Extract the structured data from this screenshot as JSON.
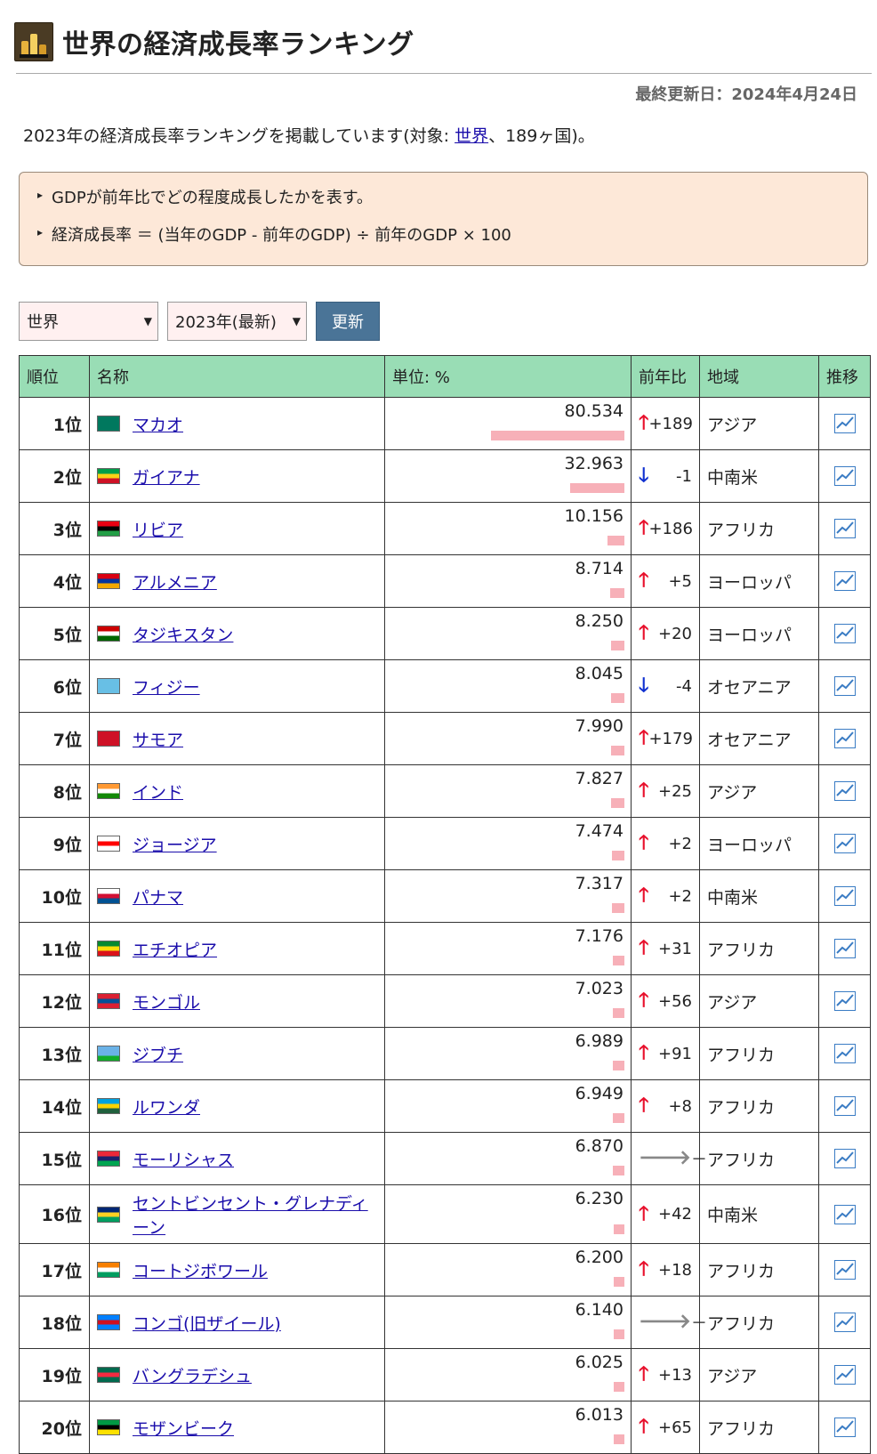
{
  "header": {
    "title": "世界の経済成長率ランキング",
    "updated": "最終更新日：2024年4月24日",
    "intro_before": "2023年の経済成長率ランキングを掲載しています(対象: ",
    "intro_link": "世界",
    "intro_after": "、189ヶ国)。"
  },
  "notes": [
    "GDPが前年比でどの程度成長したかを表す。",
    "経済成長率 ＝ (当年のGDP - 前年のGDP) ÷ 前年のGDP × 100"
  ],
  "controls": {
    "region_select": "世界",
    "year_select": "2023年(最新)",
    "update_button": "更新"
  },
  "table": {
    "headers": {
      "rank": "順位",
      "name": "名称",
      "unit": "単位: %",
      "change": "前年比",
      "region": "地域",
      "trend": "推移"
    },
    "max_value": 80.534,
    "rows": [
      {
        "rank": "1位",
        "name": "マカオ",
        "value": "80.534",
        "v": 80.534,
        "dir": "up",
        "change": "+189",
        "region": "アジア",
        "flag": [
          "#00785e",
          "#00785e",
          "#00785e"
        ]
      },
      {
        "rank": "2位",
        "name": "ガイアナ",
        "value": "32.963",
        "v": 32.963,
        "dir": "down",
        "change": "-1",
        "region": "中南米",
        "flag": [
          "#009e49",
          "#fcd116",
          "#ce1126"
        ]
      },
      {
        "rank": "3位",
        "name": "リビア",
        "value": "10.156",
        "v": 10.156,
        "dir": "up",
        "change": "+186",
        "region": "アフリカ",
        "flag": [
          "#e70013",
          "#000000",
          "#239e46"
        ]
      },
      {
        "rank": "4位",
        "name": "アルメニア",
        "value": "8.714",
        "v": 8.714,
        "dir": "up",
        "change": "+5",
        "region": "ヨーロッパ",
        "flag": [
          "#d90012",
          "#0033a0",
          "#f2a800"
        ]
      },
      {
        "rank": "5位",
        "name": "タジキスタン",
        "value": "8.250",
        "v": 8.25,
        "dir": "up",
        "change": "+20",
        "region": "ヨーロッパ",
        "flag": [
          "#cc0000",
          "#ffffff",
          "#006600"
        ]
      },
      {
        "rank": "6位",
        "name": "フィジー",
        "value": "8.045",
        "v": 8.045,
        "dir": "down",
        "change": "-4",
        "region": "オセアニア",
        "flag": [
          "#68bfe5",
          "#68bfe5",
          "#68bfe5"
        ]
      },
      {
        "rank": "7位",
        "name": "サモア",
        "value": "7.990",
        "v": 7.99,
        "dir": "up",
        "change": "+179",
        "region": "オセアニア",
        "flag": [
          "#ce1126",
          "#ce1126",
          "#ce1126"
        ]
      },
      {
        "rank": "8位",
        "name": "インド",
        "value": "7.827",
        "v": 7.827,
        "dir": "up",
        "change": "+25",
        "region": "アジア",
        "flag": [
          "#ff9933",
          "#ffffff",
          "#138808"
        ]
      },
      {
        "rank": "9位",
        "name": "ジョージア",
        "value": "7.474",
        "v": 7.474,
        "dir": "up",
        "change": "+2",
        "region": "ヨーロッパ",
        "flag": [
          "#ffffff",
          "#ff0000",
          "#ffffff"
        ]
      },
      {
        "rank": "10位",
        "name": "パナマ",
        "value": "7.317",
        "v": 7.317,
        "dir": "up",
        "change": "+2",
        "region": "中南米",
        "flag": [
          "#ffffff",
          "#d21034",
          "#005293"
        ]
      },
      {
        "rank": "11位",
        "name": "エチオピア",
        "value": "7.176",
        "v": 7.176,
        "dir": "up",
        "change": "+31",
        "region": "アフリカ",
        "flag": [
          "#078930",
          "#fcdd09",
          "#da121a"
        ]
      },
      {
        "rank": "12位",
        "name": "モンゴル",
        "value": "7.023",
        "v": 7.023,
        "dir": "up",
        "change": "+56",
        "region": "アジア",
        "flag": [
          "#da2032",
          "#015197",
          "#da2032"
        ]
      },
      {
        "rank": "13位",
        "name": "ジブチ",
        "value": "6.989",
        "v": 6.989,
        "dir": "up",
        "change": "+91",
        "region": "アフリカ",
        "flag": [
          "#6ab2e7",
          "#6ab2e7",
          "#12ad2b"
        ]
      },
      {
        "rank": "14位",
        "name": "ルワンダ",
        "value": "6.949",
        "v": 6.949,
        "dir": "up",
        "change": "+8",
        "region": "アフリカ",
        "flag": [
          "#00a1de",
          "#fad201",
          "#20603d"
        ]
      },
      {
        "rank": "15位",
        "name": "モーリシャス",
        "value": "6.870",
        "v": 6.87,
        "dir": "flat",
        "change": "－",
        "region": "アフリカ",
        "flag": [
          "#ea2839",
          "#1a206d",
          "#00a551"
        ]
      },
      {
        "rank": "16位",
        "name": "セントビンセント・グレナディーン",
        "value": "6.230",
        "v": 6.23,
        "dir": "up",
        "change": "+42",
        "region": "中南米",
        "flag": [
          "#002674",
          "#fcd022",
          "#009e60"
        ]
      },
      {
        "rank": "17位",
        "name": "コートジボワール",
        "value": "6.200",
        "v": 6.2,
        "dir": "up",
        "change": "+18",
        "region": "アフリカ",
        "flag": [
          "#f77f00",
          "#ffffff",
          "#009e60"
        ]
      },
      {
        "rank": "18位",
        "name": "コンゴ(旧ザイール)",
        "value": "6.140",
        "v": 6.14,
        "dir": "flat",
        "change": "－",
        "region": "アフリカ",
        "flag": [
          "#007fff",
          "#ce1021",
          "#007fff"
        ]
      },
      {
        "rank": "19位",
        "name": "バングラデシュ",
        "value": "6.025",
        "v": 6.025,
        "dir": "up",
        "change": "+13",
        "region": "アジア",
        "flag": [
          "#006a4e",
          "#f42a41",
          "#006a4e"
        ]
      },
      {
        "rank": "20位",
        "name": "モザンビーク",
        "value": "6.013",
        "v": 6.013,
        "dir": "up",
        "change": "+65",
        "region": "アフリカ",
        "flag": [
          "#009a44",
          "#000000",
          "#fce100"
        ]
      }
    ]
  },
  "colors": {
    "header_bg": "#99ddb5",
    "bar": "#f7b0b8",
    "up": "#e8102c",
    "down": "#1030d0",
    "flat": "#888888",
    "link": "#1a0dab"
  }
}
